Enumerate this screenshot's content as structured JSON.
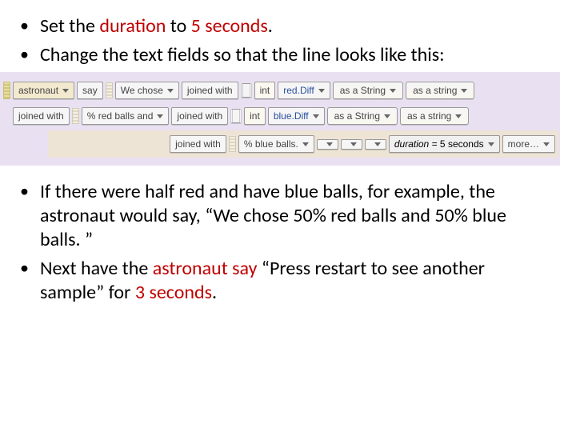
{
  "bullets_top": [
    {
      "pre": "Set the ",
      "em": "duration",
      "mid": " to ",
      "em2": "5 seconds",
      "post": "."
    },
    {
      "pre": "Change the text fields so that the line looks like this:"
    }
  ],
  "alice": {
    "row1": {
      "obj": "astronaut",
      "method": "say",
      "text1": "We chose",
      "joined": "joined with",
      "int": "int",
      "var1": "red.Diff",
      "asStr1": "as a String",
      "asStr2": "as a string"
    },
    "row2": {
      "joined1": "joined with",
      "text2": "% red balls and",
      "joined2": "joined with",
      "int": "int",
      "var2": "blue.Diff",
      "asStr1": "as a String",
      "asStr2": "as a string"
    },
    "row3": {
      "joined": "joined with",
      "text3": "% blue balls.",
      "duration_label": "duration =",
      "duration_value": "5",
      "duration_unit": "seconds",
      "more": "more…"
    }
  },
  "bullets_bottom": [
    "If there were half red and have blue balls, for example, the astronaut would say, “We chose 50% red balls and 50% blue balls. ”",
    {
      "pre": "Next have the ",
      "em": "astronaut say",
      "mid": " “Press restart to see another sample” for ",
      "em2": "3 seconds",
      "post": "."
    }
  ]
}
